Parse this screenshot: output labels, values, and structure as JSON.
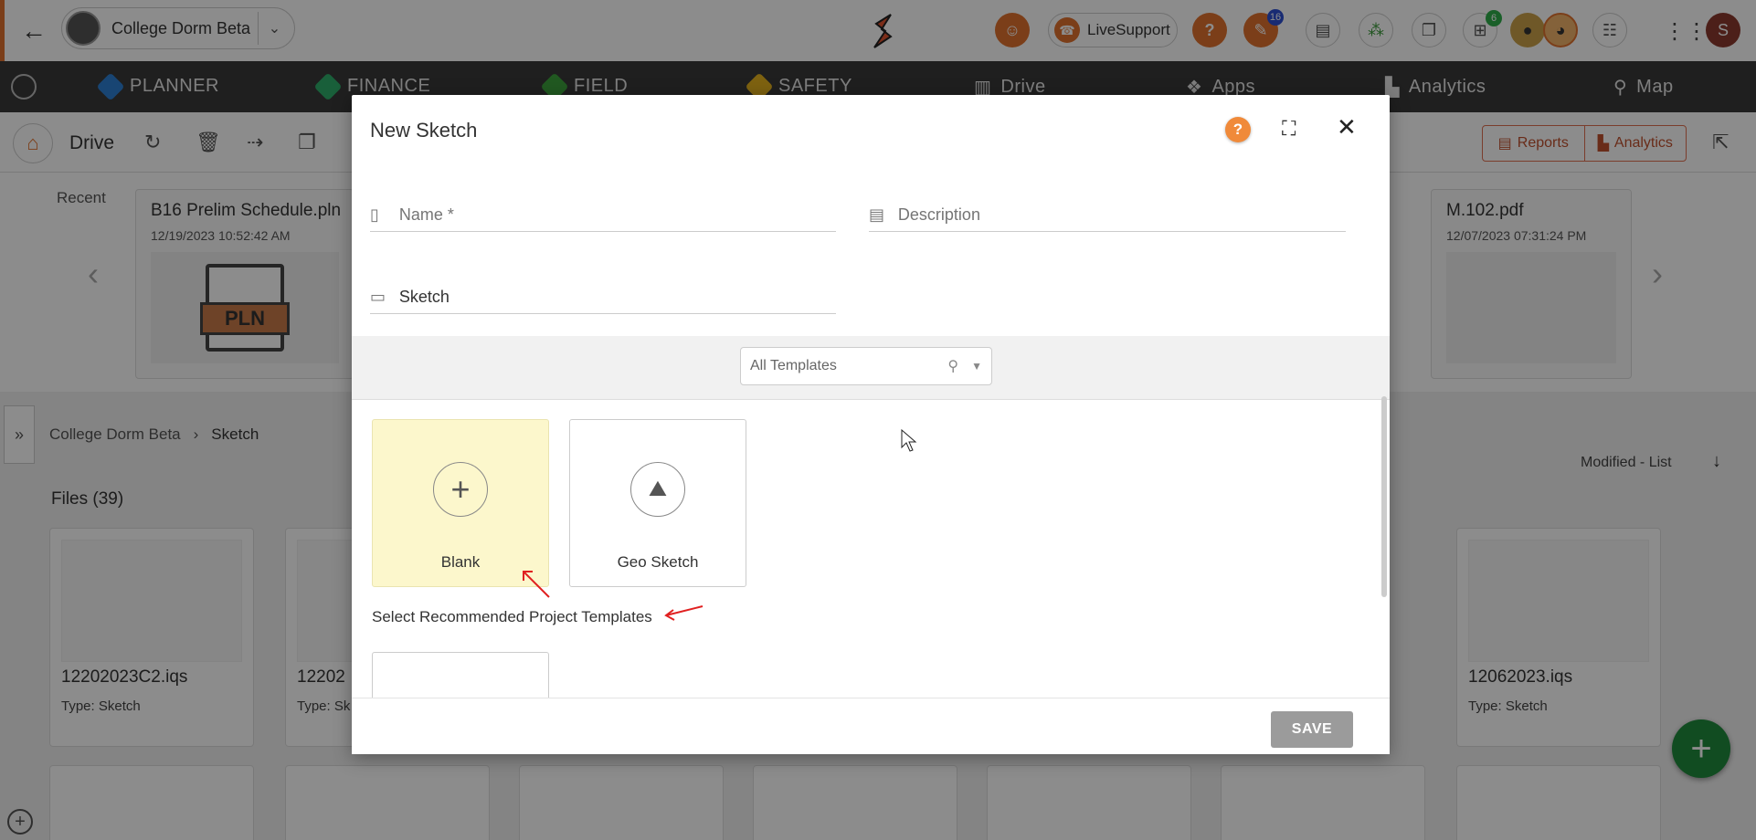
{
  "header": {
    "project_name": "College Dorm Beta",
    "live_support_label": "LiveSupport",
    "notification_badge_1": "16",
    "notification_badge_2": "6",
    "user_initial": "S"
  },
  "modules": {
    "items": [
      "PLANNER",
      "FINANCE",
      "FIELD",
      "SAFETY",
      "Drive",
      "Apps",
      "Analytics",
      "Map"
    ],
    "colors": [
      "#2d7fd1",
      "#2fae6a",
      "#3ca33c",
      "#e6b21e"
    ]
  },
  "drive": {
    "title": "Drive",
    "reports_label": "Reports",
    "analytics_label": "Analytics"
  },
  "recent": {
    "label": "Recent",
    "cards": [
      {
        "title": "B16 Prelim Schedule.pln",
        "date": "12/19/2023 10:52:42 AM",
        "thumb_label": "PLN"
      },
      {
        "title": "M.102.pdf",
        "date": "12/07/2023 07:31:24 PM"
      }
    ]
  },
  "breadcrumb": {
    "root": "College Dorm Beta",
    "current": "Sketch"
  },
  "sort": {
    "label": "Modified - List"
  },
  "files": {
    "label": "Files (39)",
    "items": [
      {
        "name": "12202023C2.iqs",
        "type": "Type:  Sketch"
      },
      {
        "name": "12202",
        "type": "Type:  Sk"
      },
      {
        "name": "12062023.iqs",
        "type": "Type:  Sketch"
      }
    ]
  },
  "modal": {
    "title": "New Sketch",
    "name_placeholder": "Name *",
    "description_placeholder": "Description",
    "folder_value": "Sketch",
    "template_filter": "All Templates",
    "templates": [
      {
        "label": "Blank",
        "icon": "plus-icon",
        "selected": true
      },
      {
        "label": "Geo Sketch",
        "icon": "map-icon",
        "selected": false
      }
    ],
    "recommended_label": "Select Recommended Project Templates",
    "save_label": "SAVE"
  },
  "colors": {
    "accent": "#e0722e",
    "selected_template_bg": "#fcf7cc",
    "save_disabled": "#9b9b9b",
    "fab": "#1f8a3c",
    "annotation": "#e02020"
  }
}
